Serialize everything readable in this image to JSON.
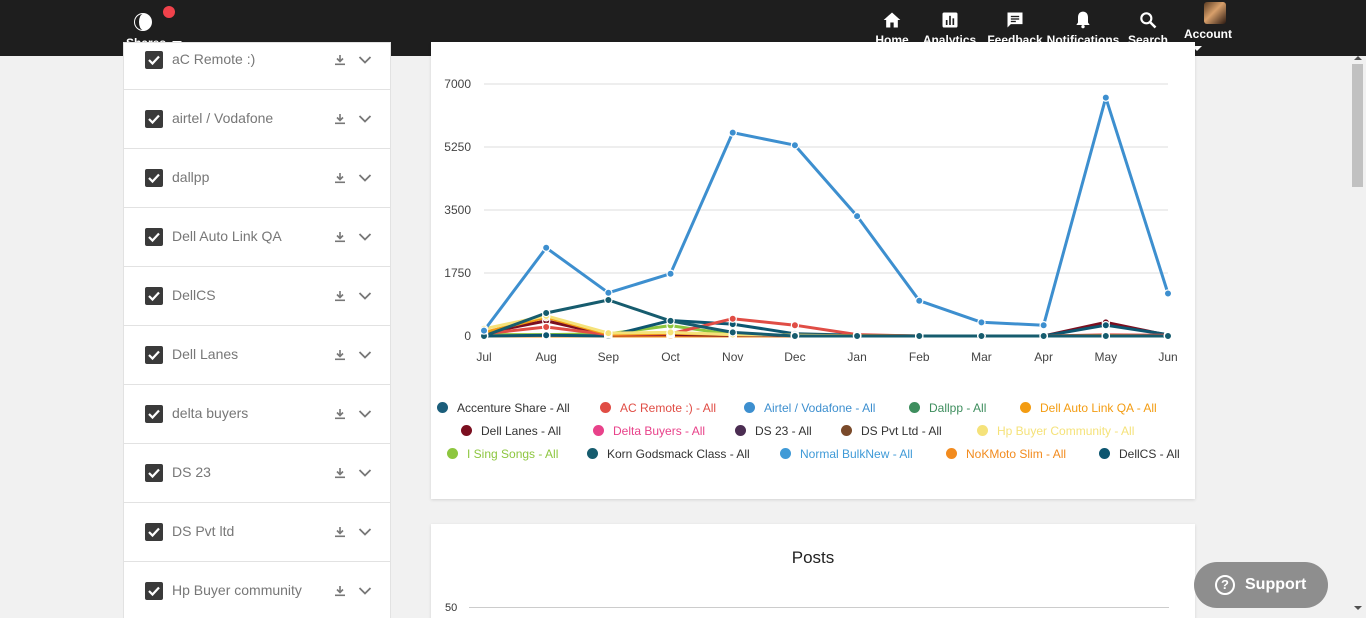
{
  "header": {
    "brand_label": "Shares",
    "nav": [
      {
        "label": "Home",
        "icon": "home-icon"
      },
      {
        "label": "Analytics",
        "icon": "analytics-icon",
        "active": true
      },
      {
        "label": "Feedback",
        "icon": "feedback-icon"
      },
      {
        "label": "Notifications",
        "icon": "bell-icon"
      },
      {
        "label": "Search",
        "icon": "search-icon"
      },
      {
        "label": "Account",
        "icon": "avatar"
      }
    ]
  },
  "sidebar": {
    "items": [
      {
        "label": "aC Remote :)",
        "checked": true
      },
      {
        "label": "airtel / Vodafone",
        "checked": true
      },
      {
        "label": "dallpp",
        "checked": true
      },
      {
        "label": "Dell Auto Link QA",
        "checked": true
      },
      {
        "label": "DellCS",
        "checked": true
      },
      {
        "label": "Dell Lanes",
        "checked": true
      },
      {
        "label": "delta buyers",
        "checked": true
      },
      {
        "label": "DS 23",
        "checked": true
      },
      {
        "label": "DS Pvt ltd",
        "checked": true
      },
      {
        "label": "Hp Buyer community",
        "checked": true
      }
    ]
  },
  "chart_data": {
    "type": "line",
    "categories": [
      "Jul",
      "Aug",
      "Sep",
      "Oct",
      "Nov",
      "Dec",
      "Jan",
      "Feb",
      "Mar",
      "Apr",
      "May",
      "Jun"
    ],
    "ylim": [
      0,
      7000
    ],
    "yticks": [
      "7000",
      "5250",
      "3500",
      "1750",
      "0"
    ],
    "grid": true,
    "legend_position": "bottom",
    "series": [
      {
        "name": "Accenture Share - All",
        "color": "#1b5e7b",
        "values": [
          0,
          0,
          0,
          0,
          0,
          0,
          0,
          0,
          0,
          0,
          0,
          0
        ]
      },
      {
        "name": "AC Remote :) - All",
        "color": "#e04d45",
        "values": [
          60,
          250,
          40,
          60,
          480,
          300,
          40,
          0,
          0,
          0,
          30,
          20
        ]
      },
      {
        "name": "Airtel / Vodafone - All",
        "color": "#3d8fcf",
        "values": [
          150,
          2450,
          1200,
          1730,
          5650,
          5300,
          3330,
          980,
          380,
          300,
          6620,
          1180
        ]
      },
      {
        "name": "Dallpp - All",
        "color": "#3e8e5e",
        "values": [
          0,
          0,
          0,
          0,
          0,
          0,
          0,
          0,
          0,
          0,
          0,
          0
        ]
      },
      {
        "name": "Dell Auto Link QA - All",
        "color": "#f39c12",
        "values": [
          100,
          520,
          50,
          80,
          40,
          20,
          10,
          0,
          0,
          0,
          10,
          0
        ]
      },
      {
        "name": "Dell Lanes - All",
        "color": "#7b0f20",
        "values": [
          80,
          420,
          30,
          40,
          20,
          10,
          0,
          0,
          0,
          0,
          380,
          20
        ]
      },
      {
        "name": "Delta Buyers - All",
        "color": "#e8428a",
        "values": [
          0,
          0,
          0,
          0,
          0,
          0,
          0,
          0,
          0,
          0,
          0,
          0
        ]
      },
      {
        "name": "DS 23 - All",
        "color": "#4b2d52",
        "values": [
          0,
          0,
          0,
          0,
          0,
          0,
          0,
          0,
          0,
          0,
          0,
          0
        ]
      },
      {
        "name": "DS Pvt Ltd - All",
        "color": "#7a4a2a",
        "values": [
          0,
          0,
          0,
          0,
          0,
          0,
          0,
          0,
          0,
          0,
          0,
          0
        ]
      },
      {
        "name": "Hp Buyer Community - All",
        "color": "#f5e27a",
        "values": [
          200,
          560,
          80,
          100,
          40,
          20,
          0,
          0,
          0,
          0,
          0,
          0
        ]
      },
      {
        "name": "I Sing Songs - All",
        "color": "#8dc63f",
        "values": [
          40,
          40,
          60,
          290,
          40,
          20,
          0,
          0,
          0,
          0,
          0,
          0
        ]
      },
      {
        "name": "Korn Godsmack Class - All",
        "color": "#165c6e",
        "values": [
          0,
          640,
          1000,
          420,
          100,
          0,
          0,
          0,
          0,
          0,
          0,
          0
        ]
      },
      {
        "name": "Normal BulkNew - All",
        "color": "#3f9ad7",
        "values": [
          0,
          0,
          0,
          0,
          0,
          0,
          0,
          0,
          0,
          0,
          0,
          0
        ]
      },
      {
        "name": "NoKMoto Slim - All",
        "color": "#f28b1e",
        "values": [
          0,
          0,
          0,
          0,
          0,
          0,
          0,
          0,
          0,
          0,
          0,
          0
        ]
      },
      {
        "name": "DellCS - All",
        "color": "#0d5670",
        "values": [
          0,
          20,
          0,
          430,
          330,
          60,
          20,
          0,
          0,
          0,
          300,
          40
        ]
      }
    ]
  },
  "posts": {
    "title": "Posts",
    "ytick_top": "50"
  },
  "support": {
    "label": "Support"
  }
}
